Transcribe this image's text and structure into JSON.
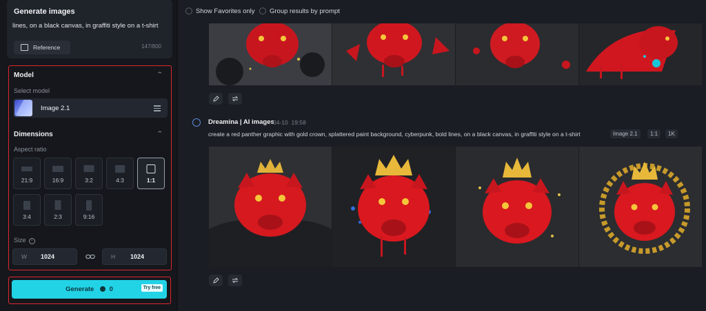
{
  "left_panel": {
    "title": "Generate images",
    "prompt_text": "lines, on a black canvas, in graffiti style on a t-shirt",
    "reference_label": "Reference",
    "char_count": "147/800",
    "model_section": {
      "title": "Model",
      "select_label": "Select model",
      "selected_model": "Image 2.1"
    },
    "dimensions_section": {
      "title": "Dimensions",
      "aspect_ratio_label": "Aspect ratio",
      "ratios": [
        "21:9",
        "16:9",
        "3:2",
        "4:3",
        "1:1",
        "3:4",
        "2:3",
        "9:16"
      ],
      "selected_ratio": "1:1",
      "size_label": "Size",
      "width_key": "W",
      "width_value": "1024",
      "height_key": "H",
      "height_value": "1024"
    },
    "generate": {
      "label": "Generate",
      "credits": "0",
      "badge": "Try free"
    }
  },
  "main": {
    "filters": {
      "show_favorites": "Show Favorites only",
      "group_results": "Group results by prompt"
    },
    "second_result": {
      "author": "Dreamina | AI images",
      "date": "04-10",
      "time": "19:58",
      "prompt": "create a red panther graphic with gold crown, splattered paint background, cyberpunk, bold lines, on a black canvas, in graffiti style on a t-shirt",
      "tags": [
        "Image 2.1",
        "1:1",
        "1K"
      ]
    }
  },
  "colors": {
    "accent": "#22d3e6",
    "highlight_border": "#e0262f",
    "background": "#15171c"
  }
}
